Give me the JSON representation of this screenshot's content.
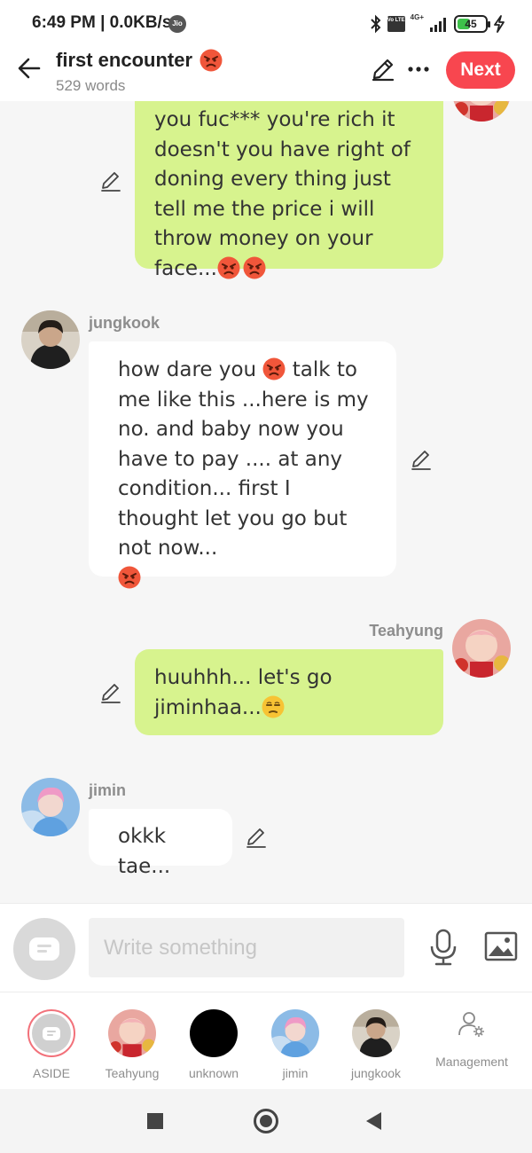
{
  "status_bar": {
    "time": "6:49 PM | 0.0KB/s",
    "carrier_badge": "Jio",
    "volte": "Vo LTE",
    "network": "4G+",
    "battery": "45",
    "icons": [
      "bluetooth-icon",
      "volte-icon",
      "signal-icon",
      "battery-icon",
      "charging-icon"
    ]
  },
  "header": {
    "title": "first encounter",
    "title_emoji": "angry-face-emoji",
    "word_count": "529 words",
    "next_label": "Next",
    "accent": "#f8464f"
  },
  "messages": [
    {
      "side": "right",
      "speaker": "",
      "text": "you fuc*** you're rich it doesn't you have right of doning every thing just tell me the price i will throw money on your face...",
      "trailing_emojis": [
        "angry-face-emoji",
        "angry-face-emoji"
      ]
    },
    {
      "side": "left",
      "speaker": "jungkook",
      "text_before": "how dare you",
      "text_after": "talk to me like this ...here is my no. and baby now you have to pay .... at any condition... first I thought let you go but not now...",
      "emojis": [
        "angry-face-emoji",
        "angry-face-emoji"
      ]
    },
    {
      "side": "right",
      "speaker": "Teahyung",
      "text": "huuhhh... let's go jiminhaa...",
      "trailing_emojis": [
        "unamused-face-emoji"
      ]
    },
    {
      "side": "left",
      "speaker": "jimin",
      "text": "okkk tae..."
    }
  ],
  "composer": {
    "placeholder": "Write something",
    "value": ""
  },
  "characters": [
    {
      "label": "ASIDE"
    },
    {
      "label": "Teahyung"
    },
    {
      "label": "unknown"
    },
    {
      "label": "jimin"
    },
    {
      "label": "jungkook"
    },
    {
      "label": "Management"
    }
  ],
  "colors": {
    "bubble_right": "#d7f38e",
    "bubble_left": "#ffffff",
    "background": "#f6f6f6"
  }
}
